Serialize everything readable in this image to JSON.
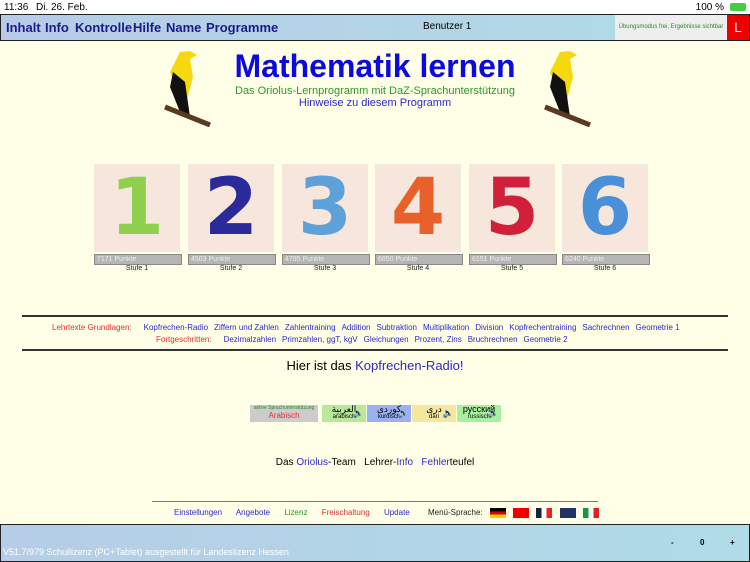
{
  "status": {
    "time": "11:36",
    "date": "Di. 26. Feb.",
    "battery": "100 %"
  },
  "menu": {
    "items": [
      "Inhalt",
      "Info",
      "Kontrolle",
      "Hilfe",
      "Name",
      "Programme"
    ],
    "user": "Benutzer 1",
    "mode": "Übungsmodus frei, Ergebnisse sichtbar",
    "l_button": "L"
  },
  "header": {
    "title": "Mathematik lernen",
    "subtitle": "Das Oriolus-Lernprogramm mit DaZ-Sprachunterstützung",
    "hint": "Hinweise zu diesem Programm"
  },
  "levels": [
    {
      "digit": "1",
      "points": "7171 Punkte",
      "label": "Stufe 1",
      "color": "#8fd14f"
    },
    {
      "digit": "2",
      "points": "4503 Punkte",
      "label": "Stufe 2",
      "color": "#2a2a9a"
    },
    {
      "digit": "3",
      "points": "4795 Punkte",
      "label": "Stufe 3",
      "color": "#5ea0d8"
    },
    {
      "digit": "4",
      "points": "6650 Punkte",
      "label": "Stufe 4",
      "color": "#e8602a"
    },
    {
      "digit": "5",
      "points": "6151 Punkte",
      "label": "Stufe 5",
      "color": "#d0203a"
    },
    {
      "digit": "6",
      "points": "6240 Punkte",
      "label": "Stufe 6",
      "color": "#4a90d8"
    }
  ],
  "lehrtexte": {
    "basics_label": "Lehrtexte Grundlagen:",
    "basics": [
      "Kopfrechen-Radio",
      "Ziffern und Zahlen",
      "Zahlentraining",
      "Addition",
      "Subtraktion",
      "Multiplikation",
      "Division",
      "Kopfrechentraining",
      "Sachrechnen",
      "Geometrie 1"
    ],
    "advanced_label": "Fortgeschritten:",
    "advanced": [
      "Dezimalzahlen",
      "Primzahlen, ggT, kgV",
      "Gleichungen",
      "Prozent, Zins",
      "Bruchrechnen",
      "Geometrie 2"
    ]
  },
  "radio": {
    "prefix": "Hier ist das ",
    "link": "Kopfrechen-Radio!"
  },
  "languages": {
    "active_label": "aktive Sprachunterstützung",
    "active": "Arabisch",
    "items": [
      {
        "script": "العربية",
        "name": "arabisch",
        "color": "#b8e89a"
      },
      {
        "script": "کوردی",
        "name": "kurdisch",
        "color": "#9ab0f0"
      },
      {
        "script": "دری",
        "name": "dari",
        "color": "#f5e7a0"
      },
      {
        "script": "русский",
        "name": "russisch",
        "color": "#a8f0a0"
      }
    ]
  },
  "team": {
    "das": "Das ",
    "oriolus": "Oriolus",
    "team": "-Team",
    "lehrer": "Lehrer-",
    "info": "Info",
    "fehler": "Fehler",
    "teufel": "teufel"
  },
  "footer": {
    "links": [
      "Einstellungen",
      "Angebote",
      "Lizenz",
      "Freischaltung",
      "Update"
    ],
    "lang_label": "Menü-Sprache:"
  },
  "bottom": {
    "license": "V51.7/979  Schullizenz (PC+Tablet) ausgestellt für Landeslizenz Hessen",
    "minus": "-",
    "value": "0",
    "plus": "+"
  }
}
